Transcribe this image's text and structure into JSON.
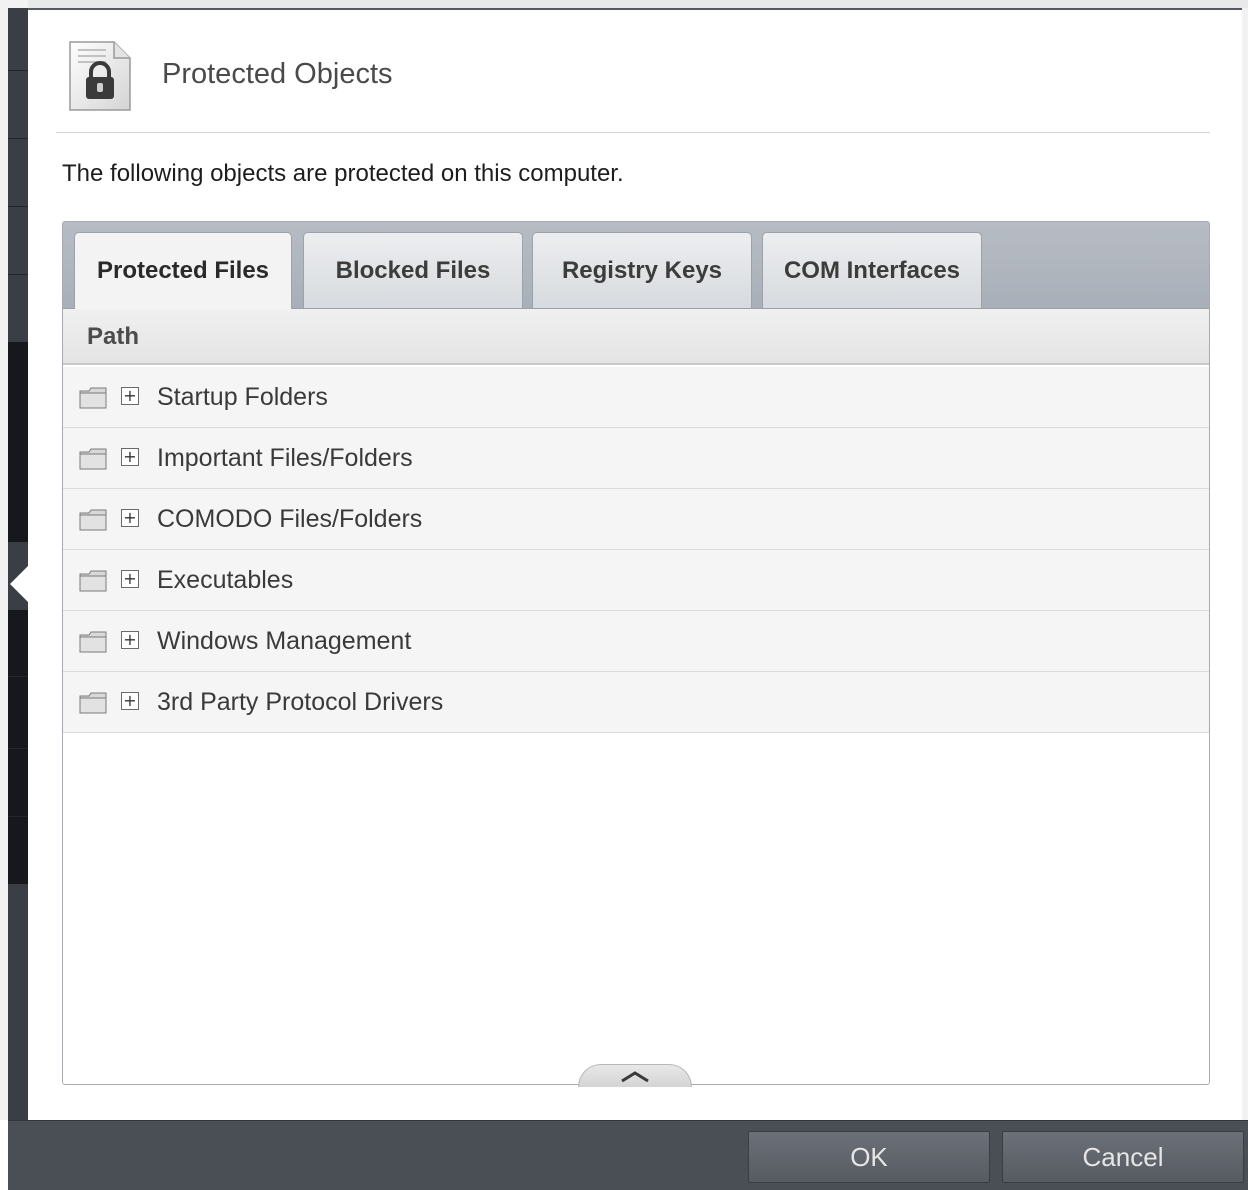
{
  "dialog": {
    "title": "Protected Objects",
    "description": "The following objects are protected on this computer."
  },
  "tabs": [
    {
      "label": "Protected Files",
      "active": true
    },
    {
      "label": "Blocked Files",
      "active": false
    },
    {
      "label": "Registry Keys",
      "active": false
    },
    {
      "label": "COM Interfaces",
      "active": false
    }
  ],
  "table": {
    "column_header": "Path",
    "rows": [
      {
        "label": "Startup Folders",
        "icon": "folder-icon",
        "expander": "+"
      },
      {
        "label": "Important Files/Folders",
        "icon": "folder-icon",
        "expander": "+"
      },
      {
        "label": "COMODO Files/Folders",
        "icon": "folder-icon",
        "expander": "+"
      },
      {
        "label": "Executables",
        "icon": "folder-icon",
        "expander": "+"
      },
      {
        "label": "Windows Management",
        "icon": "folder-icon",
        "expander": "+"
      },
      {
        "label": "3rd Party Protocol Drivers",
        "icon": "folder-icon",
        "expander": "+"
      }
    ]
  },
  "buttons": {
    "ok": "OK",
    "cancel": "Cancel"
  },
  "colors": {
    "bottom_bar": "#4a4e55",
    "tab_strip": "#b0b5bd",
    "row_background": "#f5f5f5"
  }
}
